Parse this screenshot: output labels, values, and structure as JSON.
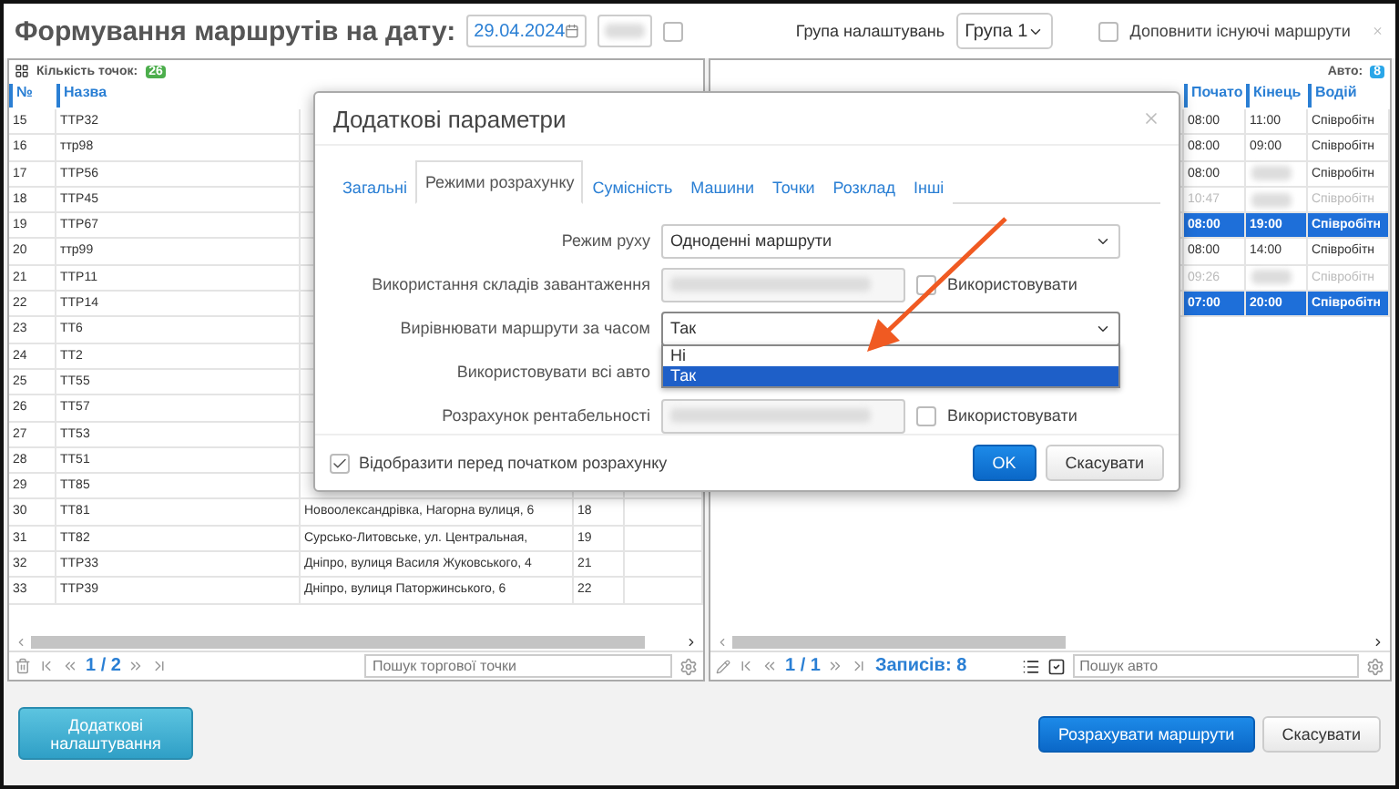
{
  "header": {
    "title": "Формування маршрутів на дату:",
    "date": "29.04.2024",
    "time_enabled": false,
    "group_label": "Група налаштувань",
    "group_value": "Група 1",
    "append": {
      "label": "Доповнити існуючі маршрути",
      "checked": false
    }
  },
  "points_panel": {
    "count_label": "Кількість точок:",
    "count": "26",
    "columns": [
      "№",
      "Назва"
    ],
    "rows": [
      {
        "cells": [
          "15",
          "ТТР32"
        ]
      },
      {
        "cells": [
          "16",
          "ттр98"
        ]
      },
      {
        "cells": [
          "17",
          "ТТР56"
        ]
      },
      {
        "cells": [
          "18",
          "ТТР45"
        ]
      },
      {
        "cells": [
          "19",
          "ТТР67"
        ]
      },
      {
        "cells": [
          "20",
          "ттр99"
        ]
      },
      {
        "cells": [
          "21",
          "ТТР11"
        ]
      },
      {
        "cells": [
          "22",
          "ТТР14"
        ]
      },
      {
        "cells": [
          "23",
          "ТТ6"
        ]
      },
      {
        "cells": [
          "24",
          "ТТ2"
        ]
      },
      {
        "cells": [
          "25",
          "ТТ55"
        ]
      },
      {
        "cells": [
          "26",
          "ТТ57"
        ]
      },
      {
        "cells": [
          "27",
          "ТТ53"
        ]
      },
      {
        "cells": [
          "28",
          "ТТ51"
        ]
      },
      {
        "cells": [
          "29",
          "ТТ85"
        ]
      },
      {
        "cells": [
          "30",
          "ТТ81",
          "Новоолександрівка, Нагорна вулиця, 6",
          "18"
        ]
      },
      {
        "cells": [
          "31",
          "ТТ82",
          "Сурсько-Литовське,  ул. Центральная,",
          "19"
        ]
      },
      {
        "cells": [
          "32",
          "ТТР33",
          "Дніпро, вулиця Василя Жуковського, 4",
          "21"
        ]
      },
      {
        "cells": [
          "33",
          "ТТР39",
          "Дніпро, вулиця Паторжинського, 6",
          "22"
        ]
      }
    ],
    "page": "1 / 2",
    "search_placeholder": "Пошук торгової точки"
  },
  "cars_panel": {
    "count_label": "Авто:",
    "count": "8",
    "columns": [
      "Почато",
      "Кінець",
      "Водій"
    ],
    "rows": [
      {
        "start": "08:00",
        "end": "11:00",
        "driver": "Співробітн",
        "selected": false,
        "disabled": false
      },
      {
        "start": "08:00",
        "end": "09:00",
        "driver": "Співробітн",
        "selected": false,
        "disabled": false
      },
      {
        "start": "08:00",
        "end": null,
        "driver": "Співробітн",
        "selected": false,
        "disabled": false
      },
      {
        "start": "10:47",
        "end": null,
        "driver": "Співробітн",
        "selected": false,
        "disabled": true
      },
      {
        "start": "08:00",
        "end": "19:00",
        "driver": "Співробітн",
        "selected": true,
        "disabled": false
      },
      {
        "start": "08:00",
        "end": "14:00",
        "driver": "Співробітн",
        "selected": false,
        "disabled": false
      },
      {
        "start": "09:26",
        "end": null,
        "driver": "Співробітн",
        "selected": false,
        "disabled": true
      },
      {
        "start": "07:00",
        "end": "20:00",
        "driver": "Співробітн",
        "selected": true,
        "disabled": false
      }
    ],
    "page": "1 / 1",
    "records": "Записів: 8",
    "search_placeholder": "Пошук авто"
  },
  "bottom_buttons": {
    "extra": "Додаткові налаштування",
    "calculate": "Розрахувати маршрути",
    "cancel": "Скасувати"
  },
  "dialog": {
    "title": "Додаткові параметри",
    "tabs": [
      {
        "label": "Загальні",
        "selected": false
      },
      {
        "label": "Режими розрахунку",
        "selected": true
      },
      {
        "label": "Сумісність",
        "selected": false
      },
      {
        "label": "Машини",
        "selected": false
      },
      {
        "label": "Точки",
        "selected": false
      },
      {
        "label": "Розклад",
        "selected": false
      },
      {
        "label": "Інші",
        "selected": false
      }
    ],
    "fields": [
      {
        "label": "Режим руху",
        "value": "Одноденні маршрути",
        "disabled": false,
        "open": false
      },
      {
        "label": "Використання складів завантаження",
        "disabled": true,
        "open": false,
        "use": {
          "label": "Використовувати",
          "checked": false
        }
      },
      {
        "label": "Вирівнювати маршрути за часом",
        "value": "Так",
        "disabled": false,
        "open": true,
        "options": [
          {
            "label": "Ні",
            "selected": false
          },
          {
            "label": "Так",
            "selected": true
          }
        ]
      },
      {
        "label": "Використовувати всі авто"
      },
      {
        "label": "Розрахунок рентабельності",
        "disabled": true,
        "open": false,
        "use": {
          "label": "Використовувати",
          "checked": false
        }
      }
    ],
    "show_before": {
      "label": "Відобразити перед початком розрахунку",
      "checked": true
    },
    "ok": "OK",
    "cancel": "Скасувати"
  }
}
